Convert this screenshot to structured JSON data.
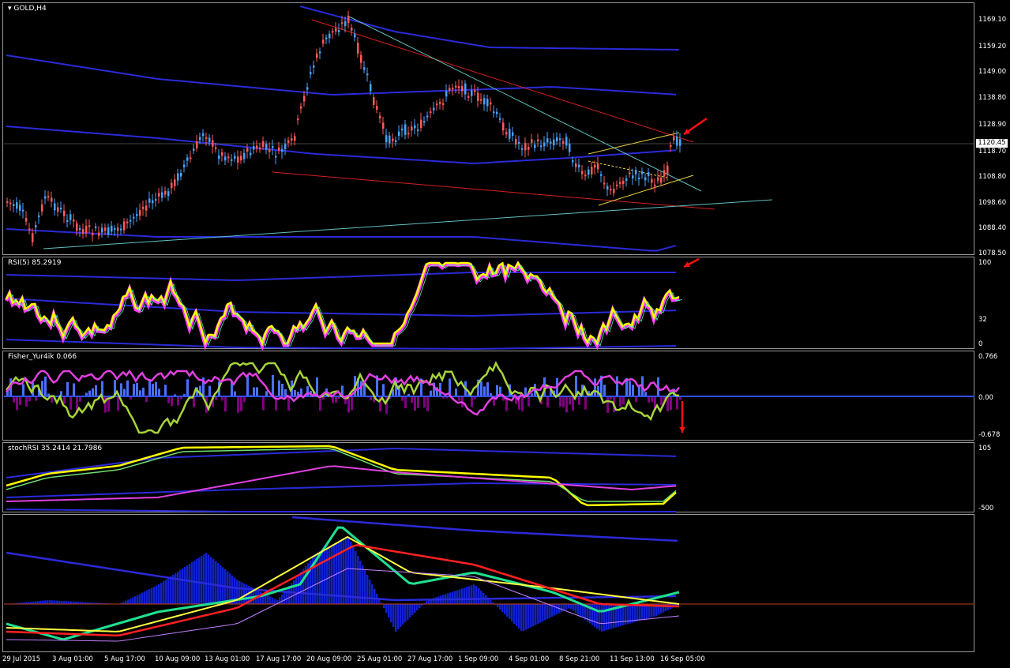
{
  "window": {
    "title": "GOLD,H4"
  },
  "main_chart": {
    "current_price": "1120.45",
    "price_axis": [
      "1169.10",
      "1159.20",
      "1149.00",
      "1138.80",
      "1128.90",
      "1118.70",
      "1108.80",
      "1098.60",
      "1088.40",
      "1078.50"
    ]
  },
  "rsi": {
    "label": "RSI(5) 85.2919",
    "axis": [
      "100",
      "32",
      "0"
    ]
  },
  "fisher": {
    "label": "Fisher_Yur4ik 0.066",
    "axis": [
      "0.766",
      "0.00",
      "-0.678"
    ]
  },
  "stochrsi": {
    "label": "stochRSI 35.2414 21.7986",
    "axis": [
      "105",
      "-500"
    ]
  },
  "time_axis": [
    "29 Jul 2015",
    "3 Aug 01:00",
    "5 Aug 17:00",
    "10 Aug 09:00",
    "13 Aug 01:00",
    "17 Aug 17:00",
    "20 Aug 09:00",
    "25 Aug 01:00",
    "27 Aug 17:00",
    "1 Sep 09:00",
    "4 Sep 01:00",
    "8 Sep 21:00",
    "11 Sep 13:00",
    "16 Sep 05:00"
  ],
  "colors": {
    "bull": "#4aa3ff",
    "bear": "#ff5a5a",
    "bands": "#2a2ad9",
    "rsi_line": "#ffff00",
    "rsi_shadow": "#ff3cff",
    "fisher_line": "#a8d43a",
    "stoch_line": "#ffff00",
    "arrow": "#ff1010"
  }
}
